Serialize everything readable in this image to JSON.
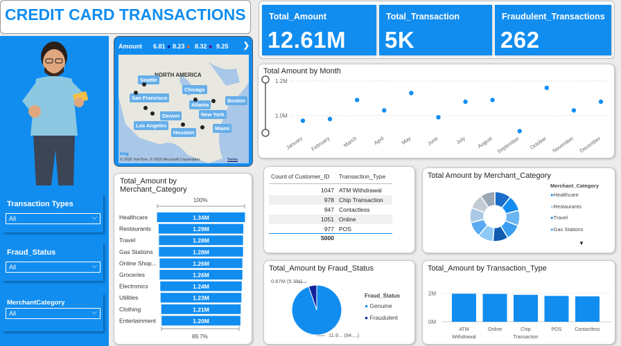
{
  "title": "CREDIT CARD TRANSACTIONS",
  "kpis": [
    {
      "label": "Total_Amount",
      "value": "12.61M"
    },
    {
      "label": "Total_Transaction",
      "value": "5K"
    },
    {
      "label": "Fraudulent_Transactions",
      "value": "262"
    }
  ],
  "slicers": [
    {
      "title": "Transaction Types",
      "value": "All"
    },
    {
      "title": "Fraud_Status",
      "value": "All"
    },
    {
      "title": "MerchantCategory",
      "value": "All"
    }
  ],
  "map": {
    "title": "Amount",
    "legend": [
      {
        "label": "6.81",
        "color": "#118df0"
      },
      {
        "label": "8.23",
        "color": "#12239e"
      },
      {
        "label": "8.32",
        "color": "#e66c37"
      },
      {
        "label": "9.25",
        "color": "#6b007b"
      }
    ],
    "region_label": "NORTH AMERICA",
    "cities": [
      "Seattle",
      "San Francisco",
      "Los Angeles",
      "Denver",
      "Houston",
      "Chicago",
      "Atlanta",
      "New York",
      "Boston",
      "Miami"
    ],
    "copyright": "© 2025 TomTom, © 2025 Microsoft Corporation",
    "terms": "Terms",
    "bing": "bing"
  },
  "month_chart": {
    "title": "Total Amount by Month",
    "y_ticks": [
      "1.2M",
      "1.0M"
    ],
    "chart_data": {
      "type": "scatter",
      "x": [
        "January",
        "February",
        "March",
        "April",
        "May",
        "June",
        "July",
        "August",
        "September",
        "October",
        "November",
        "December"
      ],
      "values": [
        0.97,
        0.98,
        1.09,
        1.03,
        1.13,
        0.99,
        1.08,
        1.09,
        0.91,
        1.16,
        1.03,
        1.08
      ],
      "ylim": [
        0.9,
        1.2
      ]
    }
  },
  "merchant_bar": {
    "title_line1": "Total_Amount by",
    "title_line2": "Merchant_Category",
    "top_label": "100%",
    "bottom_label": "89.7%",
    "chart_data": {
      "type": "bar",
      "categories": [
        "Healthcare",
        "Restaurants",
        "Travel",
        "Gas Stations",
        "Online Shop...",
        "Groceries",
        "Electronics",
        "Utilities",
        "Clothing",
        "Entertainment"
      ],
      "labels": [
        "1.34M",
        "1.29M",
        "1.28M",
        "1.28M",
        "1.26M",
        "1.26M",
        "1.24M",
        "1.23M",
        "1.21M",
        "1.20M"
      ],
      "values": [
        1.34,
        1.29,
        1.28,
        1.28,
        1.26,
        1.26,
        1.24,
        1.23,
        1.21,
        1.2
      ]
    }
  },
  "table": {
    "headers": [
      "Count of Customer_ID",
      "Transaction_Type"
    ],
    "rows": [
      {
        "count": "1047",
        "type": "ATM Withdrawal"
      },
      {
        "count": "978",
        "type": "Chip Transaction"
      },
      {
        "count": "947",
        "type": "Contactless"
      },
      {
        "count": "1051",
        "type": "Online"
      },
      {
        "count": "977",
        "type": "POS"
      }
    ],
    "total": "5000"
  },
  "donut": {
    "title": "Total Amount by Merchant_Category",
    "legend_title": "Merchant_Category",
    "legend": [
      {
        "label": "Healthcare",
        "color": "#118df0"
      },
      {
        "label": "Restaurants",
        "color": "#9fd0f7"
      },
      {
        "label": "Travel",
        "color": "#2f7fd0"
      },
      {
        "label": "Gas Stations",
        "color": "#4a9be8"
      }
    ],
    "chart_data": {
      "type": "pie",
      "categories": [
        "Healthcare",
        "Restaurants",
        "Travel",
        "Gas Stations",
        "Online Shopping",
        "Groceries",
        "Electronics",
        "Utilities",
        "Clothing",
        "Entertainment"
      ],
      "values": [
        1.34,
        1.29,
        1.28,
        1.28,
        1.26,
        1.26,
        1.24,
        1.23,
        1.21,
        1.2
      ],
      "colors": [
        "#1a6ec8",
        "#118df0",
        "#6cb6f2",
        "#3b9ef0",
        "#0f5cae",
        "#8ec8f6",
        "#5aaaf0",
        "#a9c9e6",
        "#c3ccd6",
        "#9aa7b5"
      ]
    }
  },
  "fraud_pie": {
    "title": "Total_Amount by Fraud_Status",
    "label_small": "0.67M (5.3%)",
    "label_big": "11.9... (94....)",
    "legend_title": "Fraud_Status",
    "legend": [
      {
        "label": "Genuine",
        "color": "#118df0"
      },
      {
        "label": "Fraudulent",
        "color": "#12239e"
      }
    ],
    "chart_data": {
      "type": "pie",
      "categories": [
        "Genuine",
        "Fraudulent"
      ],
      "values": [
        94.7,
        5.3
      ],
      "colors": [
        "#118df0",
        "#12239e"
      ]
    }
  },
  "type_bar": {
    "title": "Total_Amount by Transaction_Type",
    "y_ticks": [
      "2M",
      "0M"
    ],
    "chart_data": {
      "type": "bar",
      "categories": [
        "ATM Withdrawal",
        "Online",
        "Chip Transaction",
        "POS",
        "Contactless"
      ],
      "x_labels": [
        [
          "ATM",
          "Withdrawal"
        ],
        [
          "Online"
        ],
        [
          "Chip",
          "Transaction"
        ],
        [
          "POS"
        ],
        [
          "Contactless"
        ]
      ],
      "values": [
        2.64,
        2.62,
        2.53,
        2.43,
        2.39
      ],
      "ylim": [
        0,
        3.5
      ]
    }
  }
}
